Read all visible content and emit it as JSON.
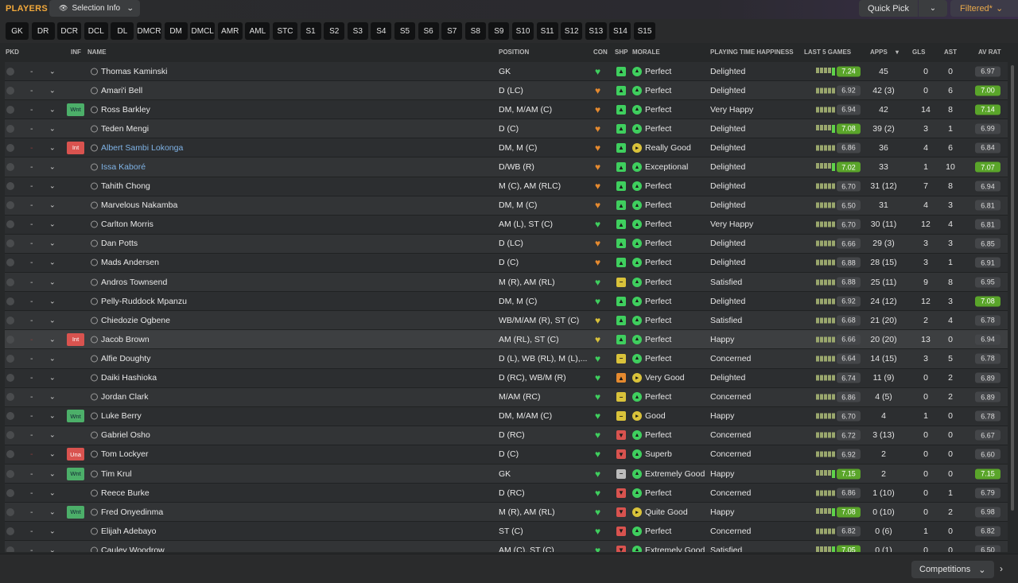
{
  "header": {
    "title": "PLAYERS",
    "selection_info": "Selection Info",
    "quick_pick": "Quick Pick",
    "filtered": "Filtered*"
  },
  "positions": [
    "GK",
    "DR",
    "DCR",
    "DCL",
    "DL",
    "DMCR",
    "DM",
    "DMCL",
    "AMR",
    "AML",
    "STC",
    "S1",
    "S2",
    "S3",
    "S4",
    "S5",
    "S6",
    "S7",
    "S8",
    "S9",
    "S10",
    "S11",
    "S12",
    "S13",
    "S14",
    "S15"
  ],
  "columns": {
    "pkd": "PKD",
    "inf": "INF",
    "name": "NAME",
    "position": "POSITION",
    "con": "CON",
    "shp": "SHP",
    "morale": "MORALE",
    "pth": "PLAYING TIME HAPPINESS",
    "last5": "LAST 5 GAMES",
    "apps": "APPS",
    "gls": "GLS",
    "ast": "AST",
    "avrat": "AV RAT"
  },
  "players": [
    {
      "name": "Thomas Kaminski",
      "inf": "",
      "pos": "GK",
      "con": "green",
      "shp": "green",
      "mor": "green",
      "morale": "Perfect",
      "pth": "Delighted",
      "l5": "7.24",
      "l5g": true,
      "apps": "45",
      "gls": "0",
      "ast": "0",
      "av": "6.97",
      "avg": false
    },
    {
      "name": "Amari'i Bell",
      "inf": "",
      "pos": "D (LC)",
      "con": "orange",
      "shp": "green",
      "mor": "green",
      "morale": "Perfect",
      "pth": "Delighted",
      "l5": "6.92",
      "l5g": false,
      "apps": "42 (3)",
      "gls": "0",
      "ast": "6",
      "av": "7.00",
      "avg": true
    },
    {
      "name": "Ross Barkley",
      "inf": "Wnt",
      "pos": "DM, M/AM (C)",
      "con": "orange",
      "shp": "green",
      "mor": "green",
      "morale": "Perfect",
      "pth": "Very Happy",
      "l5": "6.94",
      "l5g": false,
      "apps": "42",
      "gls": "14",
      "ast": "8",
      "av": "7.14",
      "avg": true
    },
    {
      "name": "Teden Mengi",
      "inf": "",
      "pos": "D (C)",
      "con": "orange",
      "shp": "green",
      "mor": "green",
      "morale": "Perfect",
      "pth": "Delighted",
      "l5": "7.08",
      "l5g": true,
      "apps": "39 (2)",
      "gls": "3",
      "ast": "1",
      "av": "6.99",
      "avg": false
    },
    {
      "name": "Albert Sambi Lokonga",
      "inf": "Int",
      "pos": "DM, M (C)",
      "con": "orange",
      "shp": "green",
      "mor": "yellow",
      "morale": "Really Good",
      "pth": "Delighted",
      "l5": "6.86",
      "l5g": false,
      "apps": "36",
      "gls": "4",
      "ast": "6",
      "av": "6.84",
      "avg": false,
      "link": true
    },
    {
      "name": "Issa Kaboré",
      "inf": "",
      "pos": "D/WB (R)",
      "con": "orange",
      "shp": "green",
      "mor": "green",
      "morale": "Exceptional",
      "pth": "Delighted",
      "l5": "7.02",
      "l5g": true,
      "apps": "33",
      "gls": "1",
      "ast": "10",
      "av": "7.07",
      "avg": true,
      "link": true
    },
    {
      "name": "Tahith Chong",
      "inf": "",
      "pos": "M (C), AM (RLC)",
      "con": "orange",
      "shp": "green",
      "mor": "green",
      "morale": "Perfect",
      "pth": "Delighted",
      "l5": "6.70",
      "l5g": false,
      "apps": "31 (12)",
      "gls": "7",
      "ast": "8",
      "av": "6.94",
      "avg": false
    },
    {
      "name": "Marvelous Nakamba",
      "inf": "",
      "pos": "DM, M (C)",
      "con": "orange",
      "shp": "green",
      "mor": "green",
      "morale": "Perfect",
      "pth": "Delighted",
      "l5": "6.50",
      "l5g": false,
      "apps": "31",
      "gls": "4",
      "ast": "3",
      "av": "6.81",
      "avg": false
    },
    {
      "name": "Carlton Morris",
      "inf": "",
      "pos": "AM (L), ST (C)",
      "con": "green",
      "shp": "green",
      "mor": "green",
      "morale": "Perfect",
      "pth": "Very Happy",
      "l5": "6.70",
      "l5g": false,
      "apps": "30 (11)",
      "gls": "12",
      "ast": "4",
      "av": "6.81",
      "avg": false
    },
    {
      "name": "Dan Potts",
      "inf": "",
      "pos": "D (LC)",
      "con": "orange",
      "shp": "green",
      "mor": "green",
      "morale": "Perfect",
      "pth": "Delighted",
      "l5": "6.66",
      "l5g": false,
      "apps": "29 (3)",
      "gls": "3",
      "ast": "3",
      "av": "6.85",
      "avg": false
    },
    {
      "name": "Mads Andersen",
      "inf": "",
      "pos": "D (C)",
      "con": "orange",
      "shp": "green",
      "mor": "green",
      "morale": "Perfect",
      "pth": "Delighted",
      "l5": "6.88",
      "l5g": false,
      "apps": "28 (15)",
      "gls": "3",
      "ast": "1",
      "av": "6.91",
      "avg": false
    },
    {
      "name": "Andros Townsend",
      "inf": "",
      "pos": "M (R), AM (RL)",
      "con": "green",
      "shp": "yellow",
      "mor": "green",
      "morale": "Perfect",
      "pth": "Satisfied",
      "l5": "6.88",
      "l5g": false,
      "apps": "25 (11)",
      "gls": "9",
      "ast": "8",
      "av": "6.95",
      "avg": false
    },
    {
      "name": "Pelly-Ruddock Mpanzu",
      "inf": "",
      "pos": "DM, M (C)",
      "con": "green",
      "shp": "green",
      "mor": "green",
      "morale": "Perfect",
      "pth": "Delighted",
      "l5": "6.92",
      "l5g": false,
      "apps": "24 (12)",
      "gls": "12",
      "ast": "3",
      "av": "7.08",
      "avg": true
    },
    {
      "name": "Chiedozie Ogbene",
      "inf": "",
      "pos": "WB/M/AM (R), ST (C)",
      "con": "yellow",
      "shp": "green",
      "mor": "green",
      "morale": "Perfect",
      "pth": "Satisfied",
      "l5": "6.68",
      "l5g": false,
      "apps": "21 (20)",
      "gls": "2",
      "ast": "4",
      "av": "6.78",
      "avg": false
    },
    {
      "name": "Jacob Brown",
      "inf": "Int",
      "pos": "AM (RL), ST (C)",
      "con": "yellow",
      "shp": "green",
      "mor": "green",
      "morale": "Perfect",
      "pth": "Happy",
      "l5": "6.66",
      "l5g": false,
      "apps": "20 (20)",
      "gls": "13",
      "ast": "0",
      "av": "6.94",
      "avg": false,
      "hl": true
    },
    {
      "name": "Alfie Doughty",
      "inf": "",
      "pos": "D (L), WB (RL), M (L),...",
      "con": "green",
      "shp": "yellow",
      "mor": "green",
      "morale": "Perfect",
      "pth": "Concerned",
      "l5": "6.64",
      "l5g": false,
      "apps": "14 (15)",
      "gls": "3",
      "ast": "5",
      "av": "6.78",
      "avg": false
    },
    {
      "name": "Daiki Hashioka",
      "inf": "",
      "pos": "D (RC), WB/M (R)",
      "con": "green",
      "shp": "orange",
      "mor": "yellow",
      "morale": "Very Good",
      "pth": "Delighted",
      "l5": "6.74",
      "l5g": false,
      "apps": "11 (9)",
      "gls": "0",
      "ast": "2",
      "av": "6.89",
      "avg": false
    },
    {
      "name": "Jordan Clark",
      "inf": "",
      "pos": "M/AM (RC)",
      "con": "green",
      "shp": "yellow",
      "mor": "green",
      "morale": "Perfect",
      "pth": "Concerned",
      "l5": "6.86",
      "l5g": false,
      "apps": "4 (5)",
      "gls": "0",
      "ast": "2",
      "av": "6.89",
      "avg": false
    },
    {
      "name": "Luke Berry",
      "inf": "Wnt",
      "pos": "DM, M/AM (C)",
      "con": "green",
      "shp": "yellow",
      "mor": "yellow",
      "morale": "Good",
      "pth": "Happy",
      "l5": "6.70",
      "l5g": false,
      "apps": "4",
      "gls": "1",
      "ast": "0",
      "av": "6.78",
      "avg": false
    },
    {
      "name": "Gabriel Osho",
      "inf": "",
      "pos": "D (RC)",
      "con": "green",
      "shp": "red",
      "mor": "green",
      "morale": "Perfect",
      "pth": "Concerned",
      "l5": "6.72",
      "l5g": false,
      "apps": "3 (13)",
      "gls": "0",
      "ast": "0",
      "av": "6.67",
      "avg": false
    },
    {
      "name": "Tom Lockyer",
      "inf": "Una",
      "pos": "D (C)",
      "con": "green",
      "shp": "red",
      "mor": "green",
      "morale": "Superb",
      "pth": "Concerned",
      "l5": "6.92",
      "l5g": false,
      "apps": "2",
      "gls": "0",
      "ast": "0",
      "av": "6.60",
      "avg": false
    },
    {
      "name": "Tim Krul",
      "inf": "Wnt",
      "pos": "GK",
      "con": "green",
      "shp": "gray",
      "mor": "green",
      "morale": "Extremely Good",
      "pth": "Happy",
      "l5": "7.15",
      "l5g": true,
      "apps": "2",
      "gls": "0",
      "ast": "0",
      "av": "7.15",
      "avg": true
    },
    {
      "name": "Reece Burke",
      "inf": "",
      "pos": "D (RC)",
      "con": "green",
      "shp": "red",
      "mor": "green",
      "morale": "Perfect",
      "pth": "Concerned",
      "l5": "6.86",
      "l5g": false,
      "apps": "1 (10)",
      "gls": "0",
      "ast": "1",
      "av": "6.79",
      "avg": false
    },
    {
      "name": "Fred Onyedinma",
      "inf": "Wnt",
      "pos": "M (R), AM (RL)",
      "con": "green",
      "shp": "red",
      "mor": "yellow",
      "morale": "Quite Good",
      "pth": "Happy",
      "l5": "7.08",
      "l5g": true,
      "apps": "0 (10)",
      "gls": "0",
      "ast": "2",
      "av": "6.98",
      "avg": false
    },
    {
      "name": "Elijah Adebayo",
      "inf": "",
      "pos": "ST (C)",
      "con": "green",
      "shp": "red",
      "mor": "green",
      "morale": "Perfect",
      "pth": "Concerned",
      "l5": "6.82",
      "l5g": false,
      "apps": "0 (6)",
      "gls": "1",
      "ast": "0",
      "av": "6.82",
      "avg": false
    },
    {
      "name": "Cauley Woodrow",
      "inf": "",
      "pos": "AM (C), ST (C)",
      "con": "green",
      "shp": "red",
      "mor": "green",
      "morale": "Extremely Good",
      "pth": "Satisfied",
      "l5": "7.05",
      "l5g": true,
      "apps": "0 (1)",
      "gls": "0",
      "ast": "0",
      "av": "6.50",
      "avg": false
    }
  ],
  "footer": {
    "competitions": "Competitions"
  },
  "colors": {
    "accent": "#f2a93b",
    "good": "#5aa52a",
    "link": "#7fb3e6",
    "bad": "#d9534f"
  }
}
